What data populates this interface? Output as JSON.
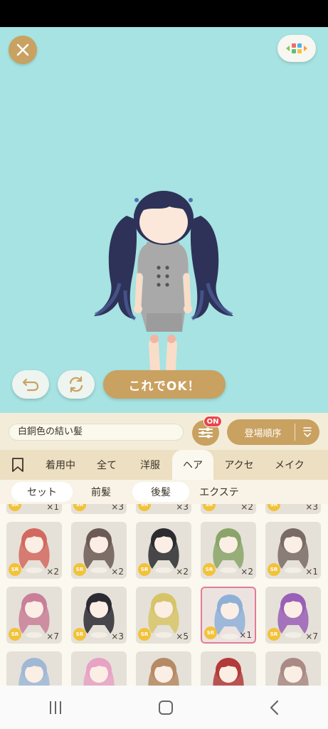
{
  "stage": {
    "background": "#a6e3e2",
    "ok_button": "これでOK！"
  },
  "item_name": "白銅色の結い髪",
  "filter_badge": "ON",
  "sort_label": "登場順序",
  "tabs": [
    {
      "label": "",
      "icon": "bookmark-icon"
    },
    {
      "label": "着用中"
    },
    {
      "label": "全て"
    },
    {
      "label": "洋服"
    },
    {
      "label": "ヘア",
      "active": true
    },
    {
      "label": "アクセ"
    },
    {
      "label": "メイク"
    }
  ],
  "subtabs": [
    {
      "label": "セット",
      "active": true
    },
    {
      "label": "前髪"
    },
    {
      "label": "後髪",
      "active": true
    },
    {
      "label": "エクステ"
    }
  ],
  "partial_row_quantities": [
    "×1",
    "×3",
    "×3",
    "×2",
    "×3"
  ],
  "grid_items": [
    {
      "rarity": "SR",
      "qty": "×2",
      "hair_color": "#d3685f"
    },
    {
      "rarity": "SR",
      "qty": "×2",
      "hair_color": "#6b5a55"
    },
    {
      "rarity": "SR",
      "qty": "×2",
      "hair_color": "#2b2b30"
    },
    {
      "rarity": "SR",
      "qty": "×2",
      "hair_color": "#8aa46a"
    },
    {
      "rarity": "SR",
      "qty": "×1",
      "hair_color": "#7a6a66"
    },
    {
      "rarity": "SR",
      "qty": "×7",
      "hair_color": "#c97f99"
    },
    {
      "rarity": "SR",
      "qty": "×3",
      "hair_color": "#2c2a33"
    },
    {
      "rarity": "SR",
      "qty": "×5",
      "hair_color": "#d7c468"
    },
    {
      "rarity": "SR",
      "qty": "×1",
      "hair_color": "#8fb0d6",
      "selected": true
    },
    {
      "rarity": "SR",
      "qty": "×7",
      "hair_color": "#9a5fb7"
    },
    {
      "rarity": "",
      "qty": "",
      "hair_color": "#9fb8d6"
    },
    {
      "rarity": "",
      "qty": "",
      "hair_color": "#e8a2c4"
    },
    {
      "rarity": "",
      "qty": "",
      "hair_color": "#b58a64"
    },
    {
      "rarity": "",
      "qty": "",
      "hair_color": "#b23a3a"
    },
    {
      "rarity": "",
      "qty": "",
      "hair_color": "#a98a84"
    }
  ],
  "colors": {
    "gold": "#c9a160",
    "badge_red": "#e8464a",
    "selected_border": "#e27b95",
    "sr_badge": "#f2c23a"
  }
}
